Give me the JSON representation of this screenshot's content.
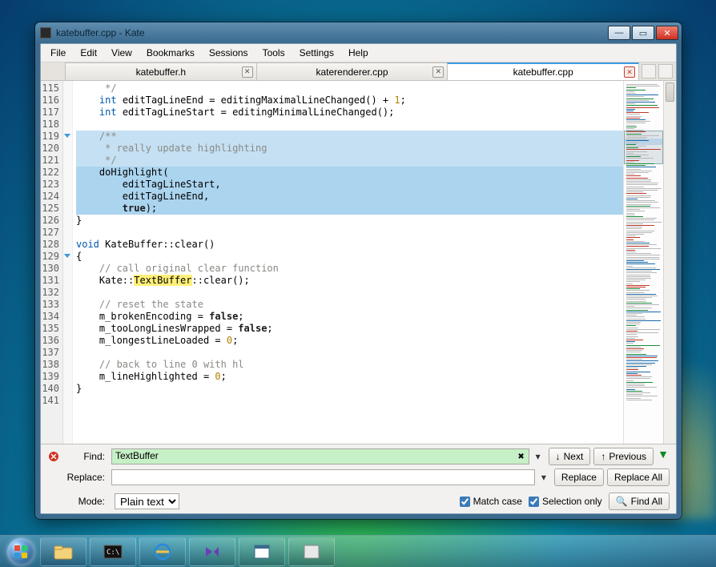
{
  "window": {
    "title": "katebuffer.cpp - Kate"
  },
  "menu": [
    "File",
    "Edit",
    "View",
    "Bookmarks",
    "Sessions",
    "Tools",
    "Settings",
    "Help"
  ],
  "tabs": [
    {
      "label": "katebuffer.h",
      "active": false
    },
    {
      "label": "katerenderer.cpp",
      "active": false
    },
    {
      "label": "katebuffer.cpp",
      "active": true
    }
  ],
  "editor": {
    "first_line_no": 115,
    "lines": [
      {
        "n": 115,
        "cls": "",
        "html": "     <span class='cmnt'>*/</span>"
      },
      {
        "n": 116,
        "cls": "",
        "html": "    <span class='type'>int</span> editTagLineEnd = editingMaximalLineChanged() + <span class='num'>1</span>;"
      },
      {
        "n": 117,
        "cls": "",
        "html": "    <span class='type'>int</span> editTagLineStart = editingMinimalLineChanged();"
      },
      {
        "n": 118,
        "cls": "",
        "html": ""
      },
      {
        "n": 119,
        "cls": "sel2",
        "html": "    <span class='cmnt'>/**</span>"
      },
      {
        "n": 120,
        "cls": "sel2",
        "html": "     <span class='cmnt'>* really update highlighting</span>"
      },
      {
        "n": 121,
        "cls": "sel2",
        "html": "     <span class='cmnt'>*/</span>"
      },
      {
        "n": 122,
        "cls": "sel",
        "html": "    doHighlight("
      },
      {
        "n": 123,
        "cls": "sel",
        "html": "        editTagLineStart,"
      },
      {
        "n": 124,
        "cls": "sel",
        "html": "        editTagLineEnd,"
      },
      {
        "n": 125,
        "cls": "sel",
        "html": "        <span class='kw'>true</span>);"
      },
      {
        "n": 126,
        "cls": "",
        "html": "}"
      },
      {
        "n": 127,
        "cls": "",
        "html": ""
      },
      {
        "n": 128,
        "cls": "",
        "html": "<span class='type'>void</span> KateBuffer::clear()"
      },
      {
        "n": 129,
        "cls": "",
        "html": "{"
      },
      {
        "n": 130,
        "cls": "",
        "html": "    <span class='cmnt'>// call original clear function</span>"
      },
      {
        "n": 131,
        "cls": "",
        "html": "    Kate::<span class='hl-word'>TextBuffer</span>::clear();"
      },
      {
        "n": 132,
        "cls": "",
        "html": ""
      },
      {
        "n": 133,
        "cls": "",
        "html": "    <span class='cmnt'>// reset the state</span>"
      },
      {
        "n": 134,
        "cls": "",
        "html": "    m_brokenEncoding = <span class='kw'>false</span>;"
      },
      {
        "n": 135,
        "cls": "",
        "html": "    m_tooLongLinesWrapped = <span class='kw'>false</span>;"
      },
      {
        "n": 136,
        "cls": "",
        "html": "    m_longestLineLoaded = <span class='num'>0</span>;"
      },
      {
        "n": 137,
        "cls": "",
        "html": ""
      },
      {
        "n": 138,
        "cls": "",
        "html": "    <span class='cmnt'>// back to line 0 with hl</span>"
      },
      {
        "n": 139,
        "cls": "",
        "html": "    m_lineHighlighted = <span class='num'>0</span>;"
      },
      {
        "n": 140,
        "cls": "",
        "html": "}"
      },
      {
        "n": 141,
        "cls": "",
        "html": ""
      }
    ],
    "fold_markers": [
      119,
      129
    ]
  },
  "search": {
    "find_label": "Find:",
    "find_value": "TextBuffer",
    "replace_label": "Replace:",
    "replace_value": "",
    "next": "Next",
    "previous": "Previous",
    "replace_btn": "Replace",
    "replace_all": "Replace All",
    "mode_label": "Mode:",
    "mode_value": "Plain text",
    "match_case": "Match case",
    "selection_only": "Selection only",
    "find_all": "Find All"
  },
  "taskbar_items": [
    "explorer",
    "terminal",
    "ie",
    "vs",
    "kate",
    "app"
  ]
}
